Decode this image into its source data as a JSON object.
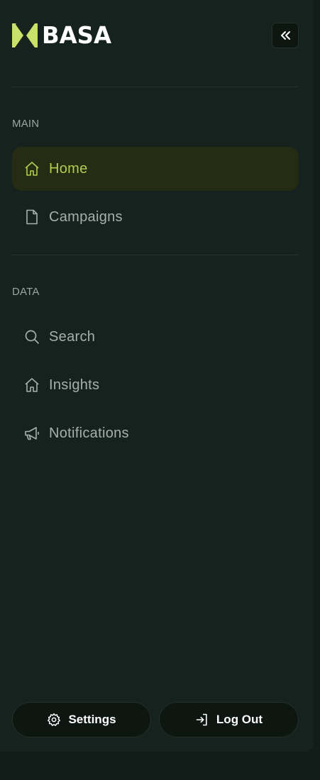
{
  "brand": {
    "name": "BASA",
    "accent": "#c9e06a"
  },
  "sidebar": {
    "collapse_icon": "double-chevron-left-icon",
    "sections": [
      {
        "label": "MAIN",
        "items": [
          {
            "label": "Home",
            "icon": "home-icon",
            "active": true
          },
          {
            "label": "Campaigns",
            "icon": "document-icon",
            "active": false
          }
        ]
      },
      {
        "label": "DATA",
        "items": [
          {
            "label": "Search",
            "icon": "search-icon",
            "active": false
          },
          {
            "label": "Insights",
            "icon": "home-icon",
            "active": false
          },
          {
            "label": "Notifications",
            "icon": "megaphone-icon",
            "active": false
          }
        ]
      }
    ],
    "footer": {
      "settings_label": "Settings",
      "logout_label": "Log Out"
    }
  },
  "colors": {
    "background": "#16221d",
    "active_bg": "#252c13",
    "active_text": "#b3cd4e",
    "muted_text": "#a6b0ab"
  }
}
